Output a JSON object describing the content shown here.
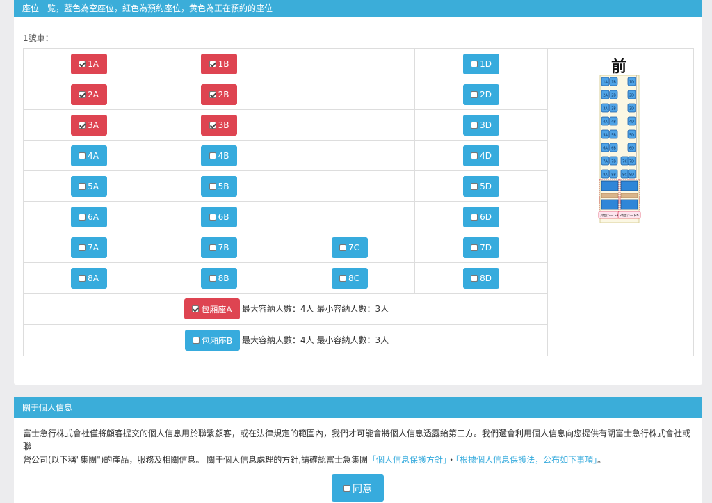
{
  "seat_panel": {
    "header": "座位一覧，藍色為空座位，紅色為預約座位，黄色為正在預約的座位",
    "car_label": "1號車："
  },
  "rows": [
    {
      "a": "1A",
      "b": "1B",
      "c": "",
      "d": "1D",
      "a_status": "reserved",
      "b_status": "reserved",
      "d_status": "empty"
    },
    {
      "a": "2A",
      "b": "2B",
      "c": "",
      "d": "2D",
      "a_status": "reserved",
      "b_status": "reserved",
      "d_status": "empty"
    },
    {
      "a": "3A",
      "b": "3B",
      "c": "",
      "d": "3D",
      "a_status": "reserved",
      "b_status": "reserved",
      "d_status": "empty"
    },
    {
      "a": "4A",
      "b": "4B",
      "c": "",
      "d": "4D",
      "a_status": "empty",
      "b_status": "empty",
      "d_status": "empty"
    },
    {
      "a": "5A",
      "b": "5B",
      "c": "",
      "d": "5D",
      "a_status": "empty",
      "b_status": "empty",
      "d_status": "empty"
    },
    {
      "a": "6A",
      "b": "6B",
      "c": "",
      "d": "6D",
      "a_status": "empty",
      "b_status": "empty",
      "d_status": "empty"
    },
    {
      "a": "7A",
      "b": "7B",
      "c": "7C",
      "d": "7D",
      "a_status": "empty",
      "b_status": "empty",
      "c_status": "empty",
      "d_status": "empty"
    },
    {
      "a": "8A",
      "b": "8B",
      "c": "8C",
      "d": "8D",
      "a_status": "empty",
      "b_status": "empty",
      "c_status": "empty",
      "d_status": "empty"
    }
  ],
  "private_rooms": [
    {
      "label": "包厢座A",
      "status": "reserved",
      "capacity": "最大容納人數：4人 最小容納人數：3人"
    },
    {
      "label": "包厢座B",
      "status": "empty",
      "capacity": "最大容納人數：4人 最小容納人數：3人"
    }
  ],
  "car_map": {
    "front_label": "前",
    "rows": [
      [
        "1A",
        "1B",
        "1D"
      ],
      [
        "2A",
        "2B",
        "2D"
      ],
      [
        "3A",
        "3B",
        "3D"
      ],
      [
        "4A",
        "4B",
        "4D"
      ],
      [
        "5A",
        "5B",
        "5D"
      ],
      [
        "6A",
        "6B",
        "6D"
      ],
      [
        "7A",
        "7B",
        "7C",
        "7D"
      ],
      [
        "8A",
        "8B",
        "8C",
        "8D"
      ]
    ],
    "room_labels": [
      "対面シートA",
      "対面シートB"
    ]
  },
  "colors": {
    "empty": "#37abdd",
    "reserved": "#de4451",
    "accent": "#3badd9"
  },
  "privacy_panel": {
    "header": "關于個人信息",
    "text_line1": "富士急行株式會社僅將顧客提交的個人信息用於聯繫顧客，或在法律規定的範圍內，我們才可能會將個人信息透露給第三方。我們還會利用個人信息向您提供有關富士急行株式會社或聯",
    "text_line2_prefix": "營公司(以下稱\"集團\")的產品，服務及相關信息。 關于個人信息處理的方針,請確認富士急集團",
    "link1": "「個人信息保護方針」",
    "sep": "・",
    "link2": "「根據個人信息保護法，公布如下事項」",
    "suffix": "。",
    "agree_label": "同意"
  }
}
